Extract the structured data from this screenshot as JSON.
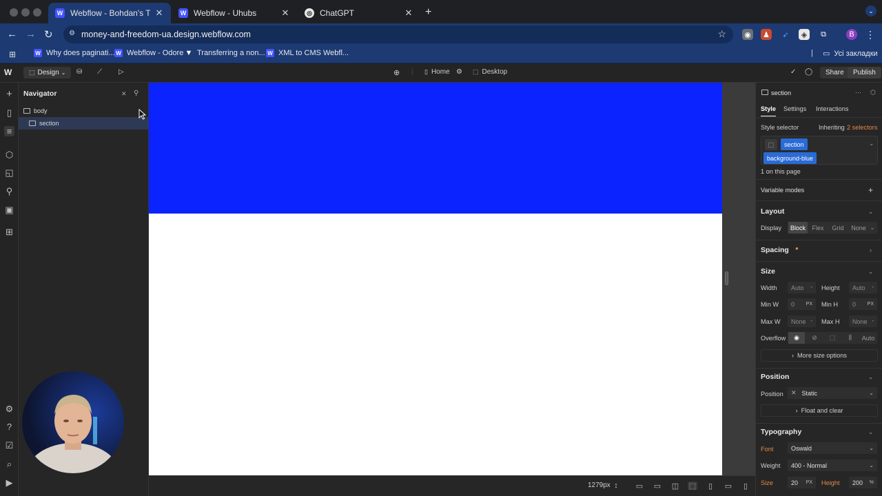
{
  "browser": {
    "tabs": [
      {
        "title": "Webflow - Bohdan's Trendy S",
        "icon": "webflow-icon"
      },
      {
        "title": "Webflow - Uhubs",
        "icon": "webflow-icon"
      },
      {
        "title": "ChatGPT",
        "icon": "chatgpt-icon"
      }
    ],
    "url": "money-and-freedom-ua.design.webflow.com",
    "profile_initial": "B",
    "bookmarks": [
      {
        "label": "Why does paginati...",
        "icon": "webflow-icon"
      },
      {
        "label": "Webflow - Odore",
        "icon": "webflow-icon"
      },
      {
        "label": "Transferring a non...",
        "icon": "webflow-icon"
      },
      {
        "label": "XML to CMS Webfl...",
        "icon": "webflow-icon"
      }
    ],
    "bookmarks_folder": "Усі закладки"
  },
  "designer": {
    "mode_label": "Design",
    "page_label": "Home",
    "breakpoint_label": "Desktop",
    "share_label": "Share",
    "publish_label": "Publish",
    "navigator": {
      "title": "Navigator",
      "tree": [
        {
          "label": "body"
        },
        {
          "label": "section"
        }
      ]
    },
    "canvas": {
      "section_color": "#0b23ff",
      "width_readout": "1279px"
    },
    "style_panel": {
      "element_name": "section",
      "tabs": [
        "Style",
        "Settings",
        "Interactions"
      ],
      "style_selector_label": "Style selector",
      "inheriting_label": "Inheriting",
      "inheriting_count": "2 selectors",
      "classes": [
        "section",
        "background-blue"
      ],
      "on_page": "1 on this page",
      "variable_modes": "Variable modes",
      "layout": {
        "title": "Layout",
        "display_label": "Display",
        "options": [
          "Block",
          "Flex",
          "Grid",
          "None"
        ]
      },
      "spacing": {
        "title": "Spacing"
      },
      "size": {
        "title": "Size",
        "width_label": "Width",
        "width_value": "Auto",
        "height_label": "Height",
        "height_value": "Auto",
        "min_w_label": "Min W",
        "min_w_value": "0",
        "min_w_unit": "PX",
        "min_h_label": "Min H",
        "min_h_value": "0",
        "min_h_unit": "PX",
        "max_w_label": "Max W",
        "max_w_value": "None",
        "max_h_label": "Max H",
        "max_h_value": "None",
        "overflow_label": "Overflow",
        "overflow_auto": "Auto",
        "more_label": "More size options"
      },
      "position": {
        "title": "Position",
        "label": "Position",
        "value": "Static",
        "float_label": "Float and clear"
      },
      "typography": {
        "title": "Typography",
        "font_label": "Font",
        "font_value": "Oswald",
        "weight_label": "Weight",
        "weight_value": "400 - Normal",
        "size_label": "Size",
        "size_value": "20",
        "size_unit": "PX",
        "height_label": "Height",
        "height_value": "200",
        "height_unit": "%"
      }
    }
  }
}
